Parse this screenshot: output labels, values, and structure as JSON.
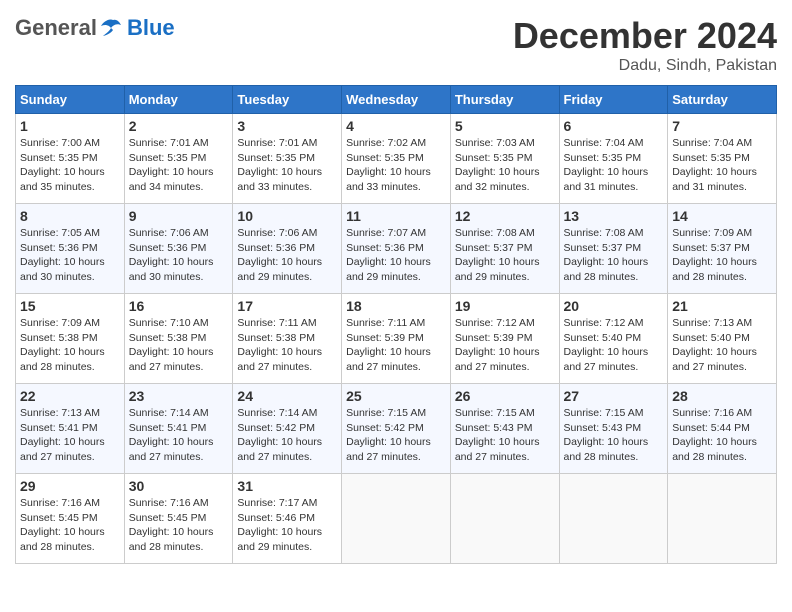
{
  "header": {
    "logo_general": "General",
    "logo_blue": "Blue",
    "month_title": "December 2024",
    "location": "Dadu, Sindh, Pakistan"
  },
  "days_of_week": [
    "Sunday",
    "Monday",
    "Tuesday",
    "Wednesday",
    "Thursday",
    "Friday",
    "Saturday"
  ],
  "weeks": [
    [
      {
        "day": "1",
        "sunrise": "7:00 AM",
        "sunset": "5:35 PM",
        "daylight": "10 hours and 35 minutes."
      },
      {
        "day": "2",
        "sunrise": "7:01 AM",
        "sunset": "5:35 PM",
        "daylight": "10 hours and 34 minutes."
      },
      {
        "day": "3",
        "sunrise": "7:01 AM",
        "sunset": "5:35 PM",
        "daylight": "10 hours and 33 minutes."
      },
      {
        "day": "4",
        "sunrise": "7:02 AM",
        "sunset": "5:35 PM",
        "daylight": "10 hours and 33 minutes."
      },
      {
        "day": "5",
        "sunrise": "7:03 AM",
        "sunset": "5:35 PM",
        "daylight": "10 hours and 32 minutes."
      },
      {
        "day": "6",
        "sunrise": "7:04 AM",
        "sunset": "5:35 PM",
        "daylight": "10 hours and 31 minutes."
      },
      {
        "day": "7",
        "sunrise": "7:04 AM",
        "sunset": "5:35 PM",
        "daylight": "10 hours and 31 minutes."
      }
    ],
    [
      {
        "day": "8",
        "sunrise": "7:05 AM",
        "sunset": "5:36 PM",
        "daylight": "10 hours and 30 minutes."
      },
      {
        "day": "9",
        "sunrise": "7:06 AM",
        "sunset": "5:36 PM",
        "daylight": "10 hours and 30 minutes."
      },
      {
        "day": "10",
        "sunrise": "7:06 AM",
        "sunset": "5:36 PM",
        "daylight": "10 hours and 29 minutes."
      },
      {
        "day": "11",
        "sunrise": "7:07 AM",
        "sunset": "5:36 PM",
        "daylight": "10 hours and 29 minutes."
      },
      {
        "day": "12",
        "sunrise": "7:08 AM",
        "sunset": "5:37 PM",
        "daylight": "10 hours and 29 minutes."
      },
      {
        "day": "13",
        "sunrise": "7:08 AM",
        "sunset": "5:37 PM",
        "daylight": "10 hours and 28 minutes."
      },
      {
        "day": "14",
        "sunrise": "7:09 AM",
        "sunset": "5:37 PM",
        "daylight": "10 hours and 28 minutes."
      }
    ],
    [
      {
        "day": "15",
        "sunrise": "7:09 AM",
        "sunset": "5:38 PM",
        "daylight": "10 hours and 28 minutes."
      },
      {
        "day": "16",
        "sunrise": "7:10 AM",
        "sunset": "5:38 PM",
        "daylight": "10 hours and 27 minutes."
      },
      {
        "day": "17",
        "sunrise": "7:11 AM",
        "sunset": "5:38 PM",
        "daylight": "10 hours and 27 minutes."
      },
      {
        "day": "18",
        "sunrise": "7:11 AM",
        "sunset": "5:39 PM",
        "daylight": "10 hours and 27 minutes."
      },
      {
        "day": "19",
        "sunrise": "7:12 AM",
        "sunset": "5:39 PM",
        "daylight": "10 hours and 27 minutes."
      },
      {
        "day": "20",
        "sunrise": "7:12 AM",
        "sunset": "5:40 PM",
        "daylight": "10 hours and 27 minutes."
      },
      {
        "day": "21",
        "sunrise": "7:13 AM",
        "sunset": "5:40 PM",
        "daylight": "10 hours and 27 minutes."
      }
    ],
    [
      {
        "day": "22",
        "sunrise": "7:13 AM",
        "sunset": "5:41 PM",
        "daylight": "10 hours and 27 minutes."
      },
      {
        "day": "23",
        "sunrise": "7:14 AM",
        "sunset": "5:41 PM",
        "daylight": "10 hours and 27 minutes."
      },
      {
        "day": "24",
        "sunrise": "7:14 AM",
        "sunset": "5:42 PM",
        "daylight": "10 hours and 27 minutes."
      },
      {
        "day": "25",
        "sunrise": "7:15 AM",
        "sunset": "5:42 PM",
        "daylight": "10 hours and 27 minutes."
      },
      {
        "day": "26",
        "sunrise": "7:15 AM",
        "sunset": "5:43 PM",
        "daylight": "10 hours and 27 minutes."
      },
      {
        "day": "27",
        "sunrise": "7:15 AM",
        "sunset": "5:43 PM",
        "daylight": "10 hours and 28 minutes."
      },
      {
        "day": "28",
        "sunrise": "7:16 AM",
        "sunset": "5:44 PM",
        "daylight": "10 hours and 28 minutes."
      }
    ],
    [
      {
        "day": "29",
        "sunrise": "7:16 AM",
        "sunset": "5:45 PM",
        "daylight": "10 hours and 28 minutes."
      },
      {
        "day": "30",
        "sunrise": "7:16 AM",
        "sunset": "5:45 PM",
        "daylight": "10 hours and 28 minutes."
      },
      {
        "day": "31",
        "sunrise": "7:17 AM",
        "sunset": "5:46 PM",
        "daylight": "10 hours and 29 minutes."
      },
      null,
      null,
      null,
      null
    ]
  ]
}
